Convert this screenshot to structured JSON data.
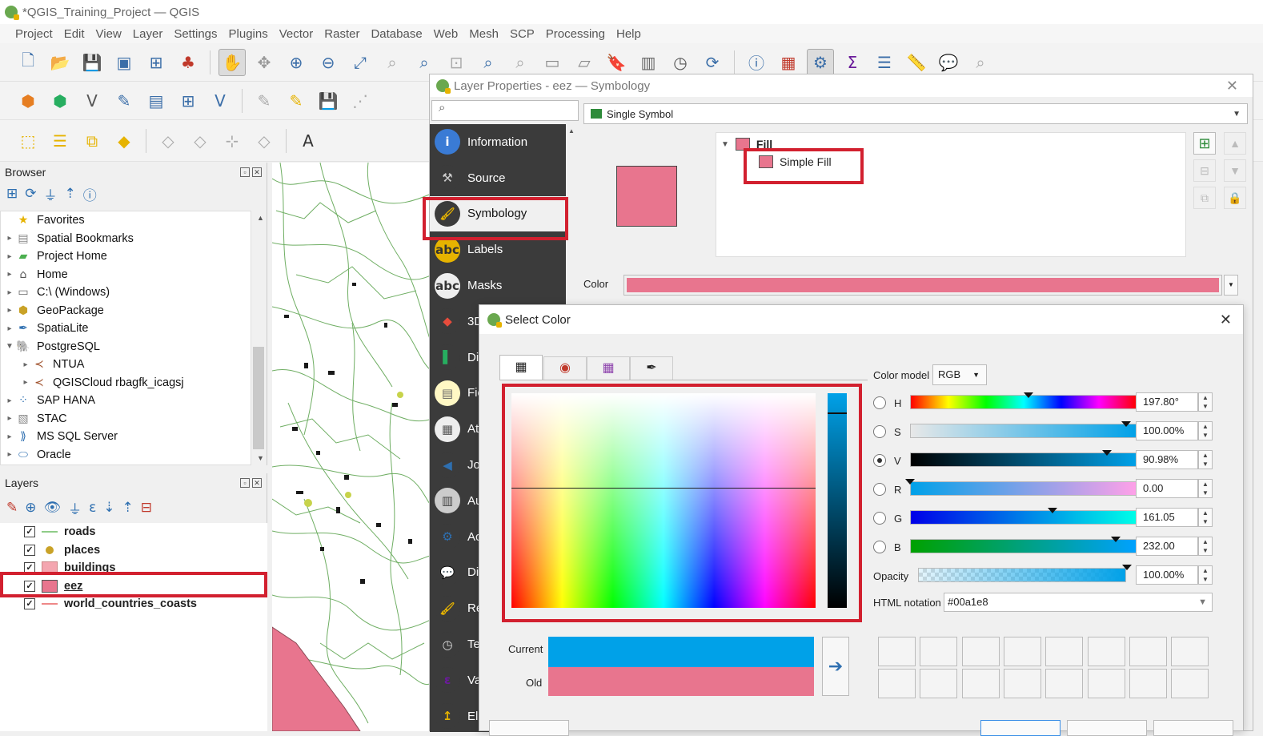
{
  "window": {
    "title": "*QGIS_Training_Project — QGIS"
  },
  "menu": [
    "Project",
    "Edit",
    "View",
    "Layer",
    "Settings",
    "Plugins",
    "Vector",
    "Raster",
    "Database",
    "Web",
    "Mesh",
    "SCP",
    "Processing",
    "Help"
  ],
  "browser": {
    "title": "Browser",
    "items": [
      {
        "label": "Favorites",
        "icon": "star-icon"
      },
      {
        "label": "Spatial Bookmarks",
        "icon": "bookmark-icon"
      },
      {
        "label": "Project Home",
        "icon": "folder-icon"
      },
      {
        "label": "Home",
        "icon": "home-icon"
      },
      {
        "label": "C:\\ (Windows)",
        "icon": "drive-icon"
      },
      {
        "label": "GeoPackage",
        "icon": "geopackage-icon"
      },
      {
        "label": "SpatiaLite",
        "icon": "spatialite-icon"
      },
      {
        "label": "PostgreSQL",
        "icon": "postgresql-icon"
      },
      {
        "label": "NTUA",
        "icon": "connection-icon"
      },
      {
        "label": "QGISCloud rbagfk_icagsj",
        "icon": "connection-icon"
      },
      {
        "label": "SAP HANA",
        "icon": "hana-icon"
      },
      {
        "label": "STAC",
        "icon": "stac-icon"
      },
      {
        "label": "MS SQL Server",
        "icon": "mssql-icon"
      },
      {
        "label": "Oracle",
        "icon": "oracle-icon"
      }
    ]
  },
  "layers": {
    "title": "Layers",
    "items": [
      {
        "label": "roads",
        "checked": "✓"
      },
      {
        "label": "places",
        "checked": "✓"
      },
      {
        "label": "buildings",
        "checked": "✓"
      },
      {
        "label": "eez",
        "checked": "✓"
      },
      {
        "label": "world_countries_coasts",
        "checked": "✓"
      }
    ]
  },
  "layer_properties": {
    "title": "Layer Properties - eez — Symbology",
    "renderer": "Single Symbol",
    "nav": [
      "Information",
      "Source",
      "Symbology",
      "Labels",
      "Masks",
      "3D",
      "Di",
      "Fie",
      "At",
      "Jo",
      "Au",
      "Ac",
      "Di",
      "Re",
      "Te",
      "Va",
      "Ele"
    ],
    "tree_root": "Fill",
    "tree_child": "Simple Fill",
    "color_label": "Color",
    "symbol_color": "#e8758e"
  },
  "select_color": {
    "title": "Select Color",
    "color_model_label": "Color model",
    "color_model": "RGB",
    "channels": [
      {
        "key": "H",
        "value": "197.80°",
        "selected": false
      },
      {
        "key": "S",
        "value": "100.00%",
        "selected": false
      },
      {
        "key": "V",
        "value": "90.98%",
        "selected": true
      },
      {
        "key": "R",
        "value": "0.00",
        "selected": false
      },
      {
        "key": "G",
        "value": "161.05",
        "selected": false
      },
      {
        "key": "B",
        "value": "232.00",
        "selected": false
      }
    ],
    "opacity_label": "Opacity",
    "opacity_value": "100.00%",
    "html_label": "HTML notation",
    "html_value": "#00a1e8",
    "current_label": "Current",
    "old_label": "Old",
    "current_color": "#00a1e8",
    "old_color": "#e8758e"
  }
}
